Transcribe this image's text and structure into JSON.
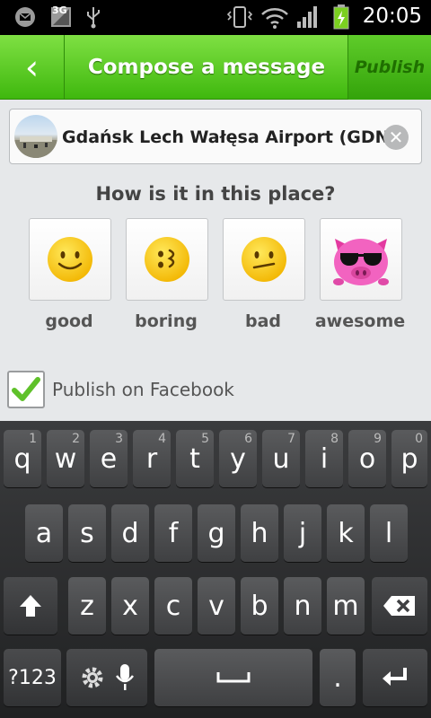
{
  "status_bar": {
    "time": "20:05",
    "network": "3G",
    "icons": [
      "gmail-icon",
      "network-3g-icon",
      "usb-icon",
      "vibrate-icon",
      "wifi-icon",
      "signal-icon",
      "battery-charging-icon"
    ]
  },
  "header": {
    "back_symbol": "‹",
    "title": "Compose a message",
    "publish_label": "Publish"
  },
  "place": {
    "name": "Gdańsk Lech Wałęsa Airport (GDN)",
    "clear_symbol": "✕"
  },
  "question": "How is it in this place?",
  "moods": [
    {
      "label": "good",
      "icon": "smiley-happy-icon"
    },
    {
      "label": "boring",
      "icon": "smiley-bored-icon"
    },
    {
      "label": "bad",
      "icon": "smiley-sad-icon"
    },
    {
      "label": "awesome",
      "icon": "pig-sunglasses-icon"
    }
  ],
  "facebook": {
    "label": "Publish on Facebook",
    "checked": true
  },
  "keyboard": {
    "row1": [
      {
        "k": "q",
        "h": "1"
      },
      {
        "k": "w",
        "h": "2"
      },
      {
        "k": "e",
        "h": "3"
      },
      {
        "k": "r",
        "h": "4"
      },
      {
        "k": "t",
        "h": "5"
      },
      {
        "k": "y",
        "h": "6"
      },
      {
        "k": "u",
        "h": "7"
      },
      {
        "k": "i",
        "h": "8"
      },
      {
        "k": "o",
        "h": "9"
      },
      {
        "k": "p",
        "h": "0"
      }
    ],
    "row2": [
      "a",
      "s",
      "d",
      "f",
      "g",
      "h",
      "j",
      "k",
      "l"
    ],
    "row3": [
      "z",
      "x",
      "c",
      "v",
      "b",
      "n",
      "m"
    ],
    "symbols_label": "?123",
    "period": "."
  }
}
